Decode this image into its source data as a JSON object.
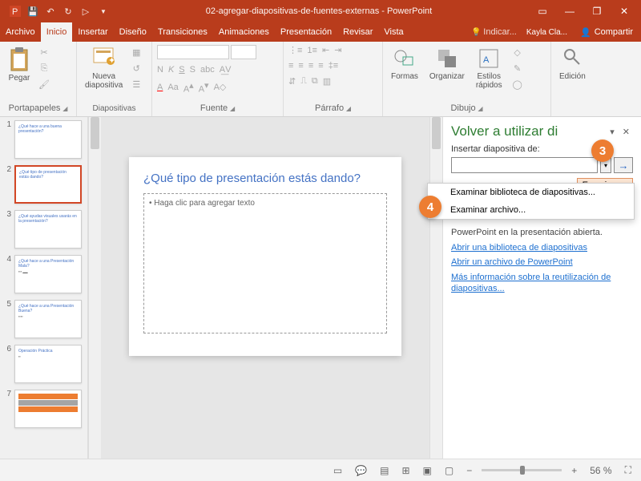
{
  "titlebar": {
    "title": "02-agregar-diapositivas-de-fuentes-externas - PowerPoint",
    "app_icon": "P"
  },
  "menubar": {
    "tabs": [
      "Archivo",
      "Inicio",
      "Insertar",
      "Diseño",
      "Transiciones",
      "Animaciones",
      "Presentación",
      "Revisar",
      "Vista"
    ],
    "active": 1,
    "tell_me": "Indicar...",
    "user": "Kayla Cla...",
    "share": "Compartir"
  },
  "ribbon": {
    "portapapeles": {
      "paste": "Pegar",
      "label": "Portapapeles"
    },
    "diapositivas": {
      "new_slide": "Nueva\ndiapositiva",
      "label": "Diapositivas"
    },
    "fuente": {
      "label": "Fuente"
    },
    "parrafo": {
      "label": "Párrafo"
    },
    "dibujo": {
      "formas": "Formas",
      "organizar": "Organizar",
      "estilos": "Estilos\nrápidos",
      "label": "Dibujo"
    },
    "edicion": {
      "label": "Edición",
      "btn": "Edición"
    }
  },
  "thumbs": [
    {
      "n": "1",
      "title": ""
    },
    {
      "n": "2",
      "title": ""
    },
    {
      "n": "3",
      "title": ""
    },
    {
      "n": "4",
      "title": ""
    },
    {
      "n": "5",
      "title": ""
    },
    {
      "n": "6",
      "title": ""
    },
    {
      "n": "7",
      "title": ""
    }
  ],
  "slide": {
    "title": "¿Qué tipo de presentación estás dando?",
    "placeholder": "• Haga clic para agregar texto"
  },
  "taskpane": {
    "title": "Volver a utilizar di",
    "insert_label": "Insertar diapositiva de:",
    "examinar": "Examinar",
    "menu": {
      "library": "Examinar biblioteca de diapositivas...",
      "file": "Examinar archivo..."
    },
    "hint_tail": "PowerPoint en la presentación abierta.",
    "link1": "Abrir una biblioteca de diapositivas",
    "link2": "Abrir un archivo de PowerPoint",
    "link3": "Más información sobre la reutilización de diapositivas..."
  },
  "callouts": {
    "c3": "3",
    "c4": "4"
  },
  "statusbar": {
    "zoom": "56 %"
  }
}
